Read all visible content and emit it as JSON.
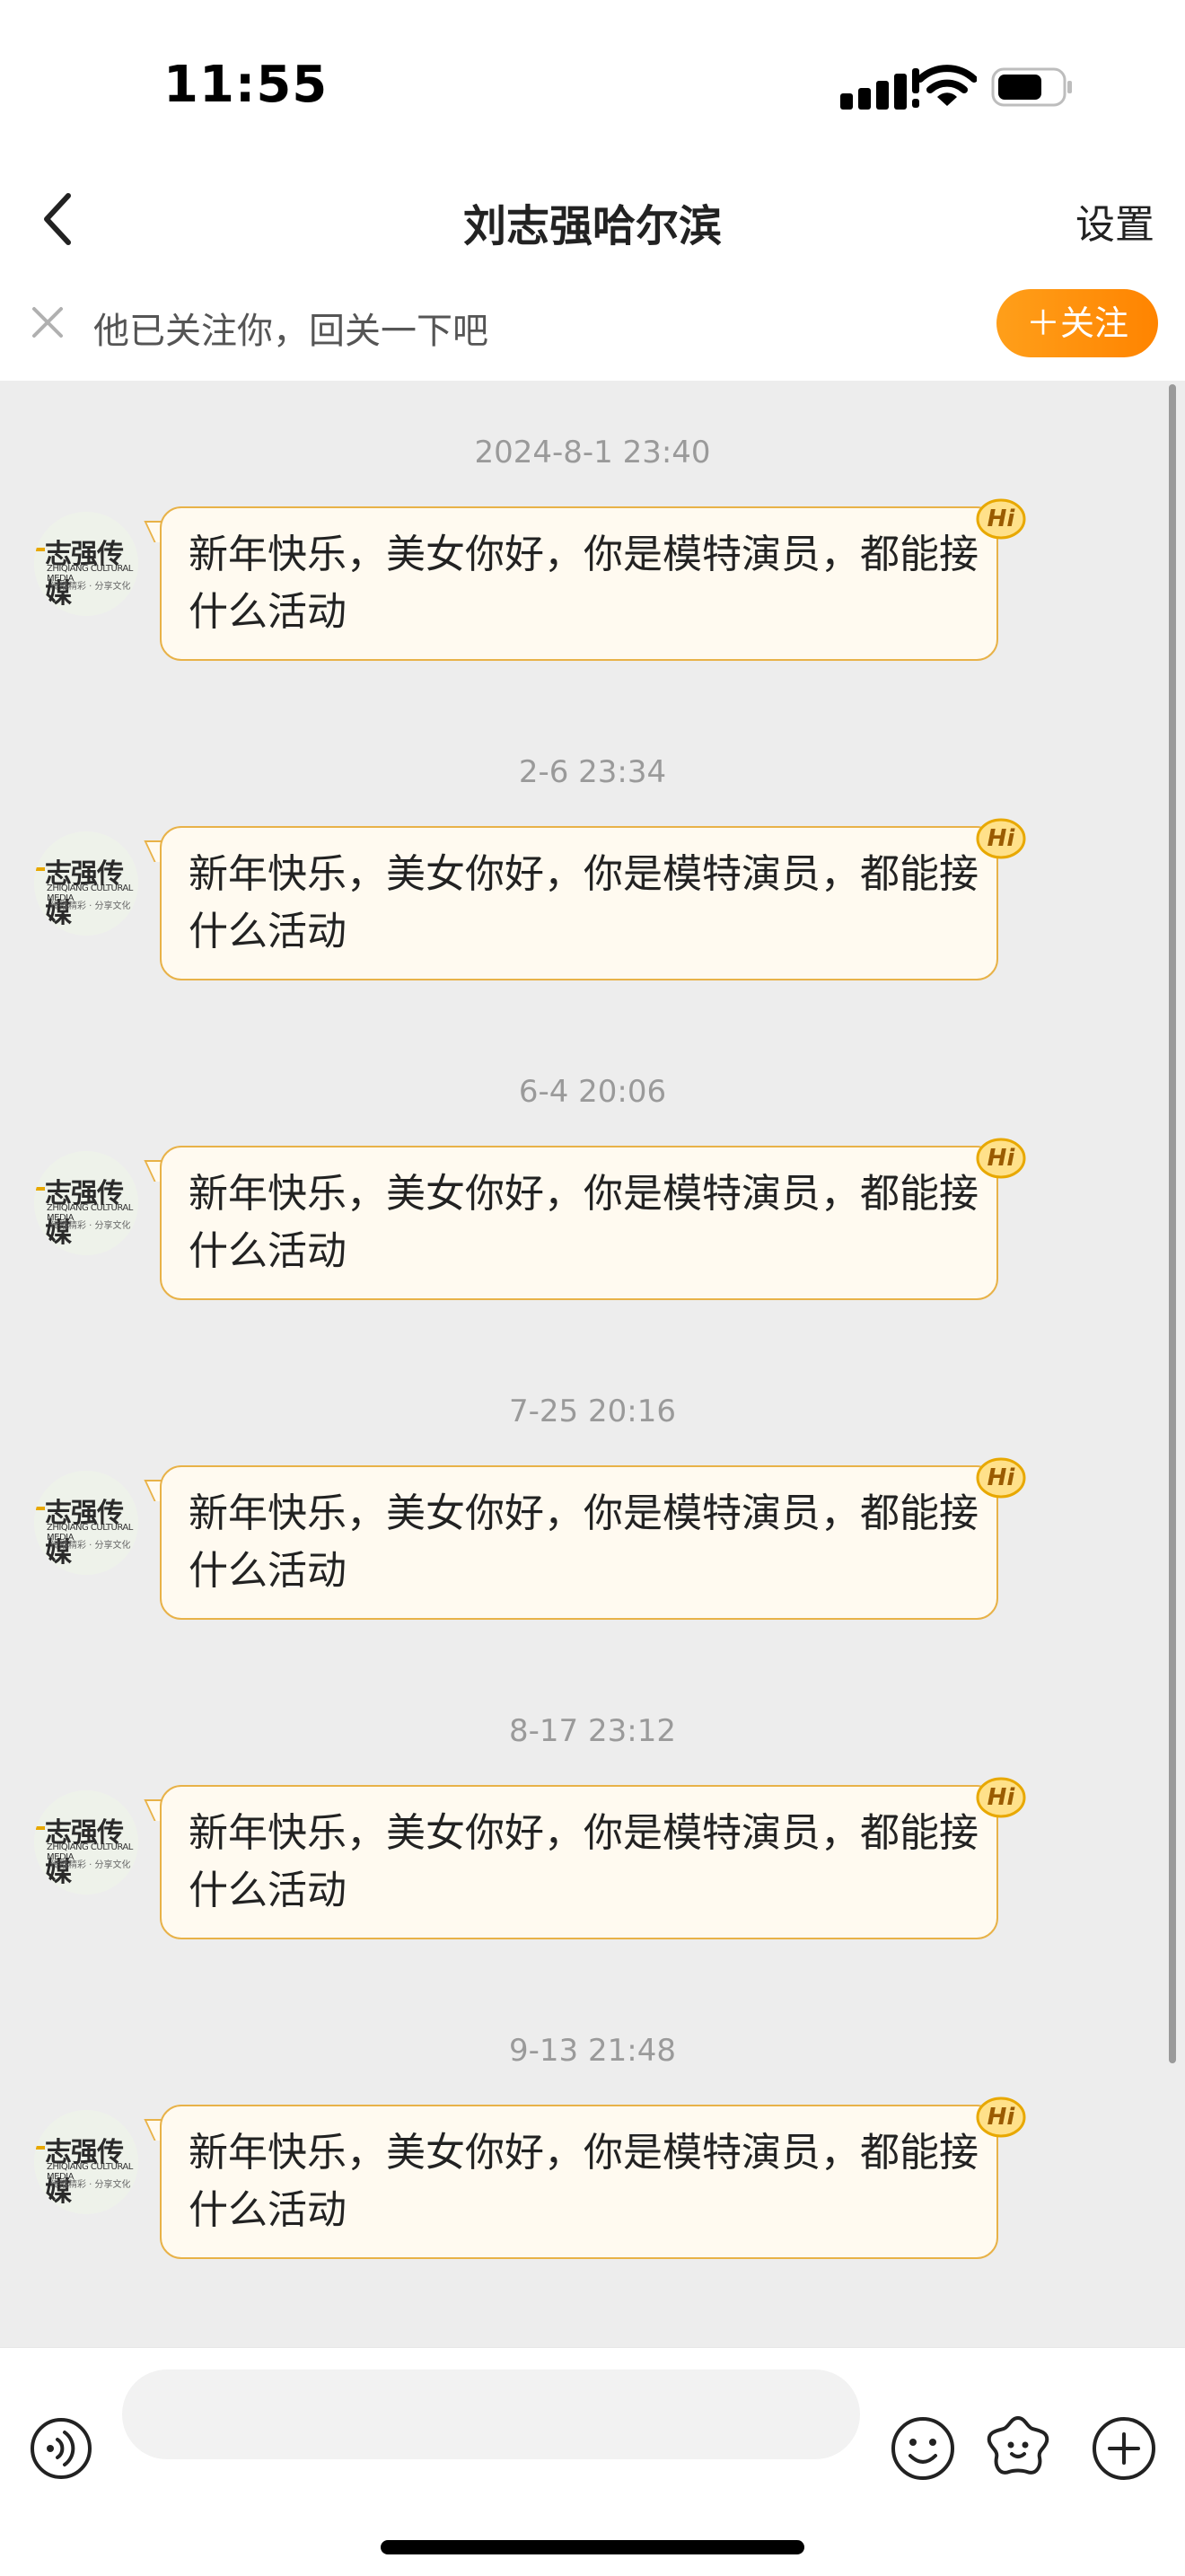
{
  "status_bar": {
    "time": "11:55"
  },
  "nav": {
    "title": "刘志强哈尔滨",
    "settings_label": "设置"
  },
  "follow_banner": {
    "text": "他已关注你，回关一下吧",
    "button_label": "＋关注"
  },
  "avatar": {
    "logo_text": "志强传媒",
    "sub_text": "ZHIQIANG CULTURAL MEDIA",
    "sub_text2": "传播精彩 · 分享文化"
  },
  "hi_badge": "Hi",
  "messages": [
    {
      "timestamp": "2024-8-1 23:40",
      "text": "新年快乐，美女你好，你是模特演员，都能接什么活动"
    },
    {
      "timestamp": "2-6 23:34",
      "text": "新年快乐，美女你好，你是模特演员，都能接什么活动"
    },
    {
      "timestamp": "6-4 20:06",
      "text": "新年快乐，美女你好，你是模特演员，都能接什么活动"
    },
    {
      "timestamp": "7-25 20:16",
      "text": "新年快乐，美女你好，你是模特演员，都能接什么活动"
    },
    {
      "timestamp": "8-17 23:12",
      "text": "新年快乐，美女你好，你是模特演员，都能接什么活动"
    },
    {
      "timestamp": "9-13 21:48",
      "text": "新年快乐，美女你好，你是模特演员，都能接什么活动"
    }
  ],
  "input": {
    "placeholder": ""
  },
  "icons": {
    "back": "chevron-left-icon",
    "close": "close-icon",
    "voice": "voice-icon",
    "emoji": "emoji-icon",
    "sticker": "sticker-icon",
    "plus": "plus-icon"
  },
  "colors": {
    "accent": "#ff8c00",
    "bubble_border": "#e8b248",
    "bubble_bg": "#fffaf0",
    "chat_bg": "#ededed"
  }
}
